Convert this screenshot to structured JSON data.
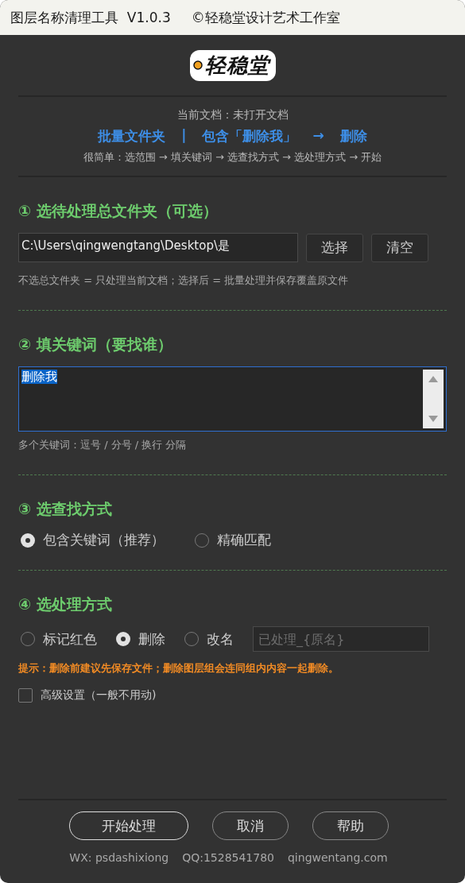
{
  "window": {
    "title": "图层名称清理工具  V1.0.3",
    "copyright": "©轻稳堂设计艺术工作室"
  },
  "logo": {
    "text": "轻稳堂"
  },
  "header": {
    "document": "当前文档：未打开文档",
    "summary": [
      "批量文件夹",
      "|",
      "包含「删除我」",
      "→",
      "删除"
    ],
    "steps": "很简单：选范围 → 填关键词 → 选查找方式 → 选处理方式 → 开始"
  },
  "folder_section": {
    "heading": "① 选待处理总文件夹（可选）",
    "path": "C:\\Users\\qingwengtang\\Desktop\\是",
    "buttons": [
      "选择",
      "清空"
    ],
    "hint": "不选总文件夹 = 只处理当前文档；选择后 = 批量处理并保存覆盖原文件"
  },
  "keyword_section": {
    "heading": "② 填关键词（要找谁）",
    "value": "删除我",
    "value_selected": true,
    "hint": "多个关键词：逗号 / 分号 / 换行 分隔"
  },
  "match_section": {
    "heading": "③ 选查找方式",
    "options": [
      {
        "label": "包含关键词（推荐）",
        "selected": true
      },
      {
        "label": "精确匹配",
        "selected": false
      }
    ]
  },
  "action_section": {
    "heading": "④ 选处理方式",
    "options": [
      {
        "label": "标记红色",
        "selected": false
      },
      {
        "label": "删除",
        "selected": true
      },
      {
        "label": "改名",
        "selected": false
      }
    ],
    "rename_placeholder": "已处理_{原名}",
    "warning": "提示：删除前建议先保存文件；删除图层组会连同组内内容一起删除。",
    "advanced": {
      "label": "高级设置（一般不用动)",
      "checked": false
    }
  },
  "buttons": [
    {
      "label": "开始处理",
      "primary": true
    },
    {
      "label": "取消",
      "primary": false
    },
    {
      "label": "帮助",
      "primary": false
    }
  ],
  "footer": [
    "WX: psdashixiong",
    "QQ:1528541780",
    "qingwentang.com"
  ]
}
